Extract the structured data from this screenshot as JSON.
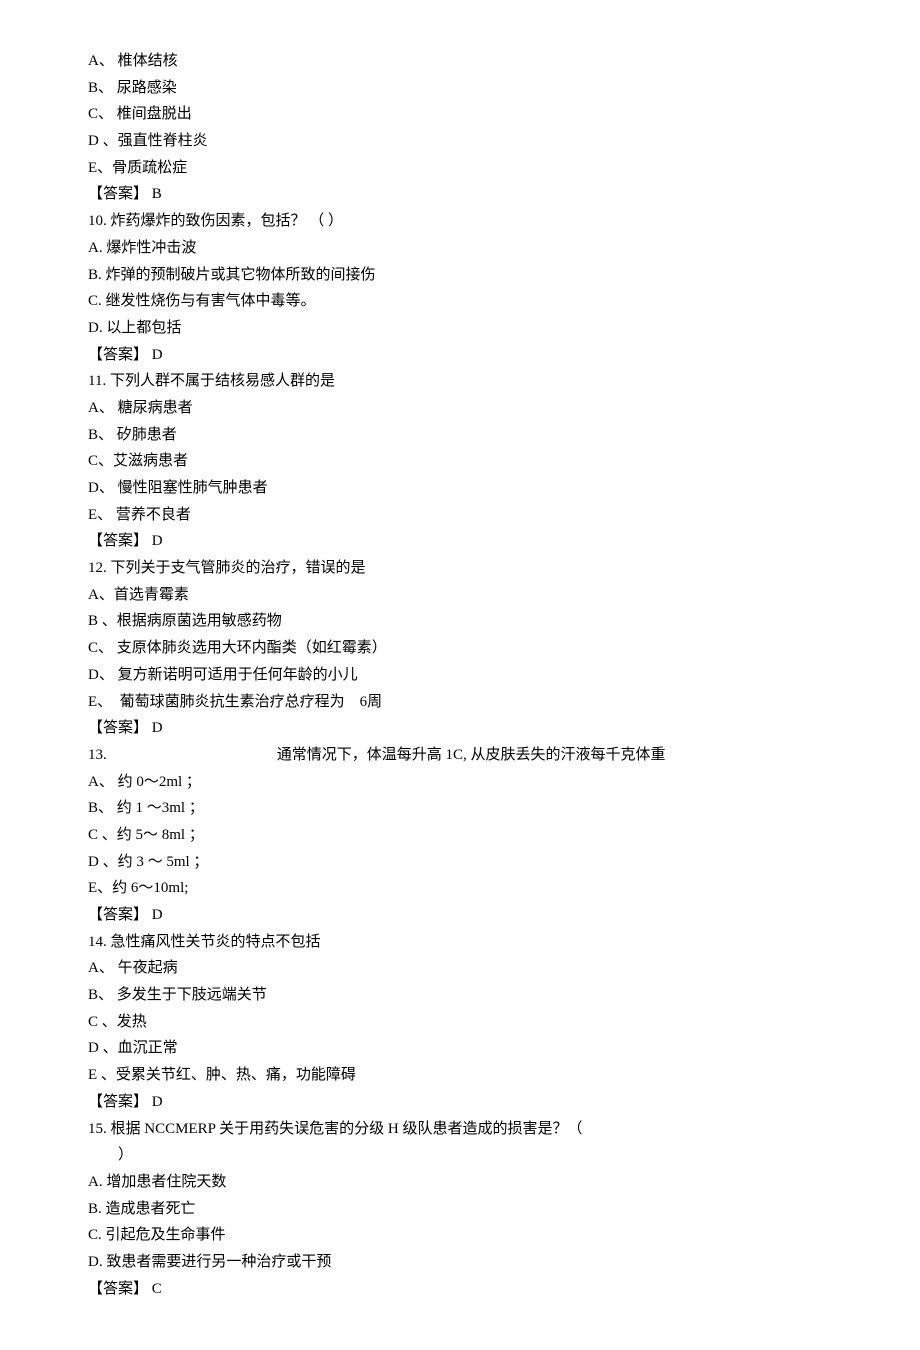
{
  "q9": {
    "A": "A、 椎体结核",
    "B": "B、 尿路感染",
    "C": "C、 椎间盘脱出",
    "D": "D 、强直性脊柱炎",
    "E": "E、骨质疏松症",
    "ans": "【答案】 B"
  },
  "q10": {
    "stem": "10. 炸药爆炸的致伤因素，包括？ （ ）",
    "A": "A. 爆炸性冲击波",
    "B": "B. 炸弹的预制破片或其它物体所致的间接伤",
    "C": "C. 继发性烧伤与有害气体中毒等。",
    "D": "D. 以上都包括",
    "ans": "【答案】 D"
  },
  "q11": {
    "stem": "11. 下列人群不属于结核易感人群的是",
    "A": "A、 糖尿病患者",
    "B": "B、 矽肺患者",
    "C": "C、艾滋病患者",
    "D": "D、 慢性阻塞性肺气肿患者",
    "E": "E、 营养不良者",
    "ans": "【答案】 D"
  },
  "q12": {
    "stem": "12. 下列关于支气管肺炎的治疗，错误的是",
    "A": "A、首选青霉素",
    "B": "B 、根据病原菌选用敏感药物",
    "C": "C、 支原体肺炎选用大环内酯类（如红霉素）",
    "D": "D、 复方新诺明可适用于任何年龄的小儿",
    "E": "E、  葡萄球菌肺炎抗生素治疗总疗程为    6周",
    "ans": "【答案】 D"
  },
  "q13": {
    "num": "13.",
    "stem": "通常情况下，体温每升高 1C, 从皮肤丢失的汗液每千克体重",
    "A": "A、 约 0～2ml ；",
    "B": "B、 约 1 ～3ml ；",
    "C": "C 、约 5～ 8ml ；",
    "D": "D 、约 3 ～ 5ml ；",
    "E": "E、约 6～10ml;",
    "ans": "【答案】 D"
  },
  "q14": {
    "stem": "14. 急性痛风性关节炎的特点不包括",
    "A": "A、 午夜起病",
    "B": "B、 多发生于下肢远端关节",
    "C": "C 、发热",
    "D": "D 、血沉正常",
    "E": "E 、受累关节红、肿、热、痛，功能障碍",
    "ans": "【答案】 D"
  },
  "q15": {
    "stem": "15. 根据 NCCMERP 关于用药失误危害的分级 H 级队患者造成的损害是？（",
    "stem2": "）",
    "A": "A. 增加患者住院天数",
    "B": "B. 造成患者死亡",
    "C": "C. 引起危及生命事件",
    "D": "D. 致患者需要进行另一种治疗或干预",
    "ans": "【答案】 C"
  }
}
